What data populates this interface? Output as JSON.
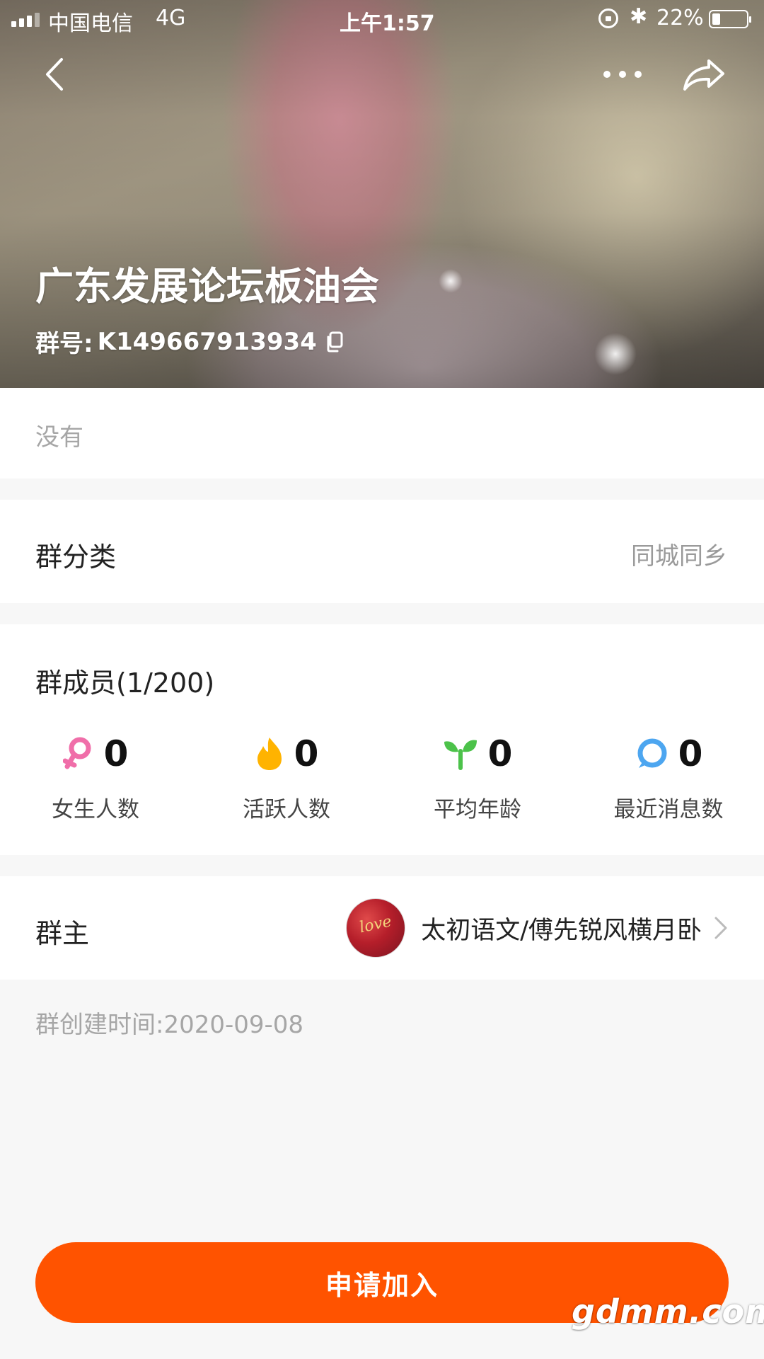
{
  "status_bar": {
    "carrier": "中国电信",
    "network": "4G",
    "time": "上午1:57",
    "battery_percent": "22%",
    "battery_level": 0.22
  },
  "header": {
    "group_name": "广东发展论坛板油会",
    "group_id_label": "群号:",
    "group_id": "K149667913934"
  },
  "description": {
    "text": "没有"
  },
  "category": {
    "label": "群分类",
    "value": "同城同乡"
  },
  "members": {
    "title": "群成员(1/200)",
    "stats": [
      {
        "icon": "female-icon",
        "value": "0",
        "label": "女生人数",
        "color": "#f06ea9"
      },
      {
        "icon": "fire-icon",
        "value": "0",
        "label": "活跃人数",
        "color": "#ffb300"
      },
      {
        "icon": "sprout-icon",
        "value": "0",
        "label": "平均年龄",
        "color": "#4cc24a"
      },
      {
        "icon": "message-icon",
        "value": "0",
        "label": "最近消息数",
        "color": "#4da6f0"
      }
    ]
  },
  "owner": {
    "label": "群主",
    "avatar_text": "love",
    "name": "太初语文/傅先锐风横月卧"
  },
  "created": {
    "text": "群创建时间:2020-09-08"
  },
  "actions": {
    "join_label": "申请加入"
  },
  "watermark": "gdmm.com",
  "colors": {
    "accent": "#ff5300",
    "page_bg": "#f7f7f7"
  }
}
